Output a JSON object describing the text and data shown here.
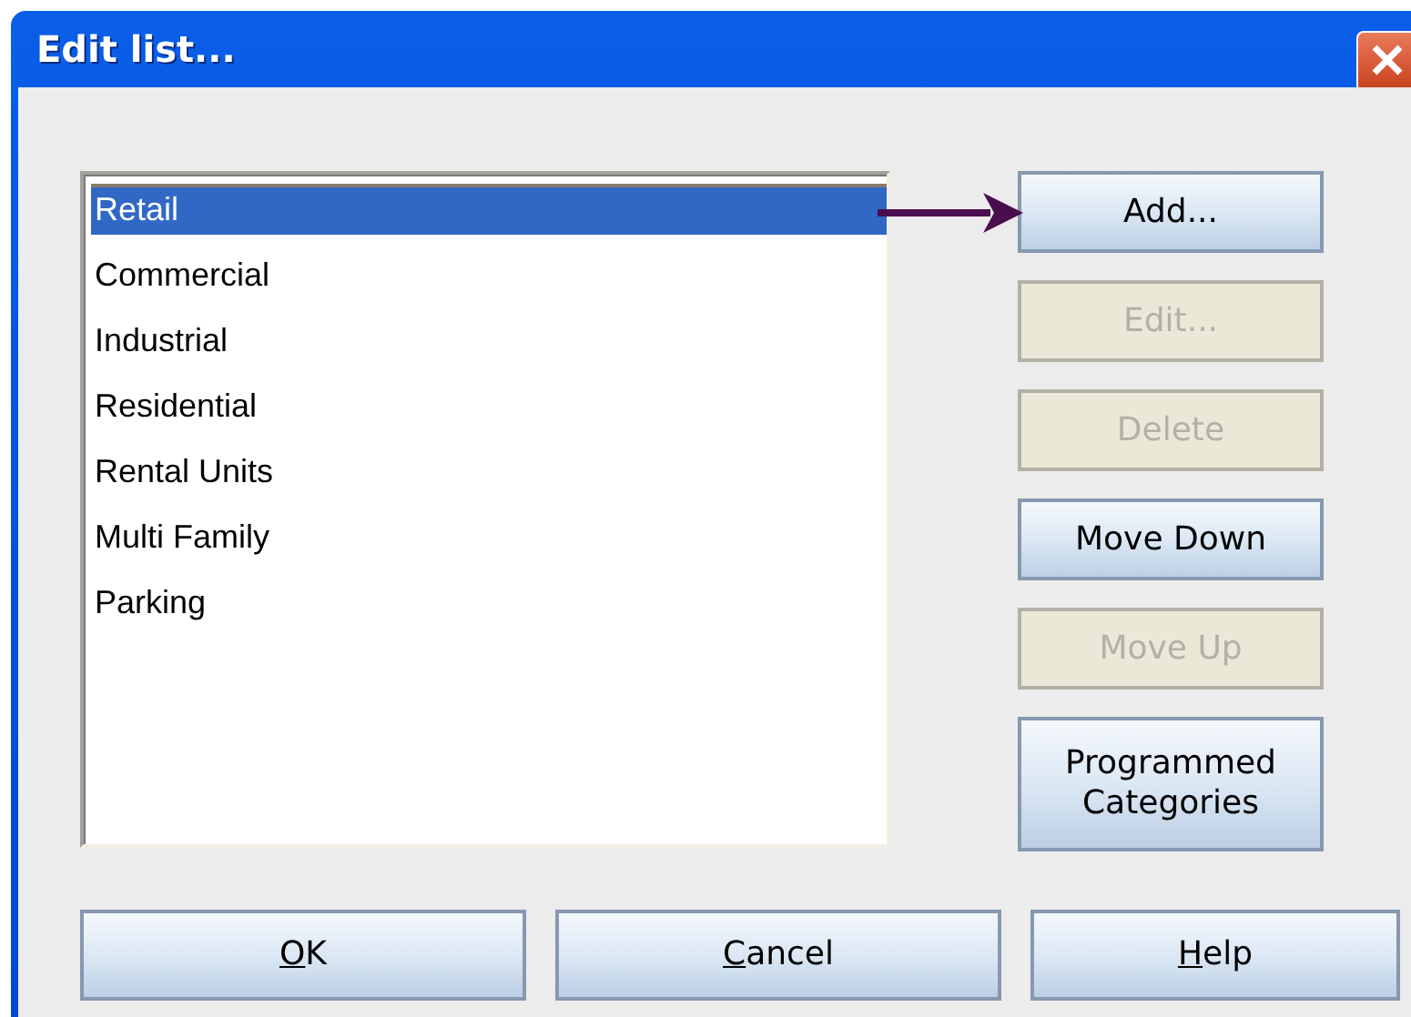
{
  "window": {
    "title": "Edit list..."
  },
  "list": {
    "items": [
      {
        "label": "Retail",
        "selected": true
      },
      {
        "label": "Commercial",
        "selected": false
      },
      {
        "label": "Industrial",
        "selected": false
      },
      {
        "label": "Residential",
        "selected": false
      },
      {
        "label": "Rental Units",
        "selected": false
      },
      {
        "label": "Multi Family",
        "selected": false
      },
      {
        "label": "Parking",
        "selected": false
      }
    ]
  },
  "side_buttons": [
    {
      "label": "Add...",
      "disabled": false
    },
    {
      "label": "Edit...",
      "disabled": true
    },
    {
      "label": "Delete",
      "disabled": true
    },
    {
      "label": "Move Down",
      "disabled": false
    },
    {
      "label": "Move Up",
      "disabled": true
    },
    {
      "label": "Programmed Categories",
      "disabled": false
    }
  ],
  "bottom_buttons": [
    {
      "label": "OK",
      "mnemonic_first": true
    },
    {
      "label": "Cancel",
      "mnemonic_first": true
    },
    {
      "label": "Help",
      "mnemonic_first": true
    }
  ]
}
